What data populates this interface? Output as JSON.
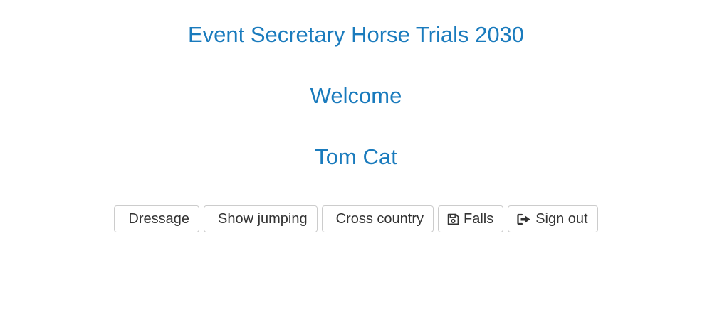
{
  "header": {
    "title": "Event Secretary Horse Trials 2030",
    "welcome": "Welcome",
    "user_name": "Tom Cat"
  },
  "toolbar": {
    "buttons": [
      {
        "label": "Dressage",
        "icon": null
      },
      {
        "label": "Show jumping",
        "icon": null
      },
      {
        "label": "Cross country",
        "icon": null
      },
      {
        "label": "Falls",
        "icon": "save-icon"
      },
      {
        "label": "Sign out",
        "icon": "sign-out-icon"
      }
    ]
  },
  "colors": {
    "heading": "#1a7bbd",
    "button_text": "#333333",
    "button_border": "#cccccc"
  }
}
